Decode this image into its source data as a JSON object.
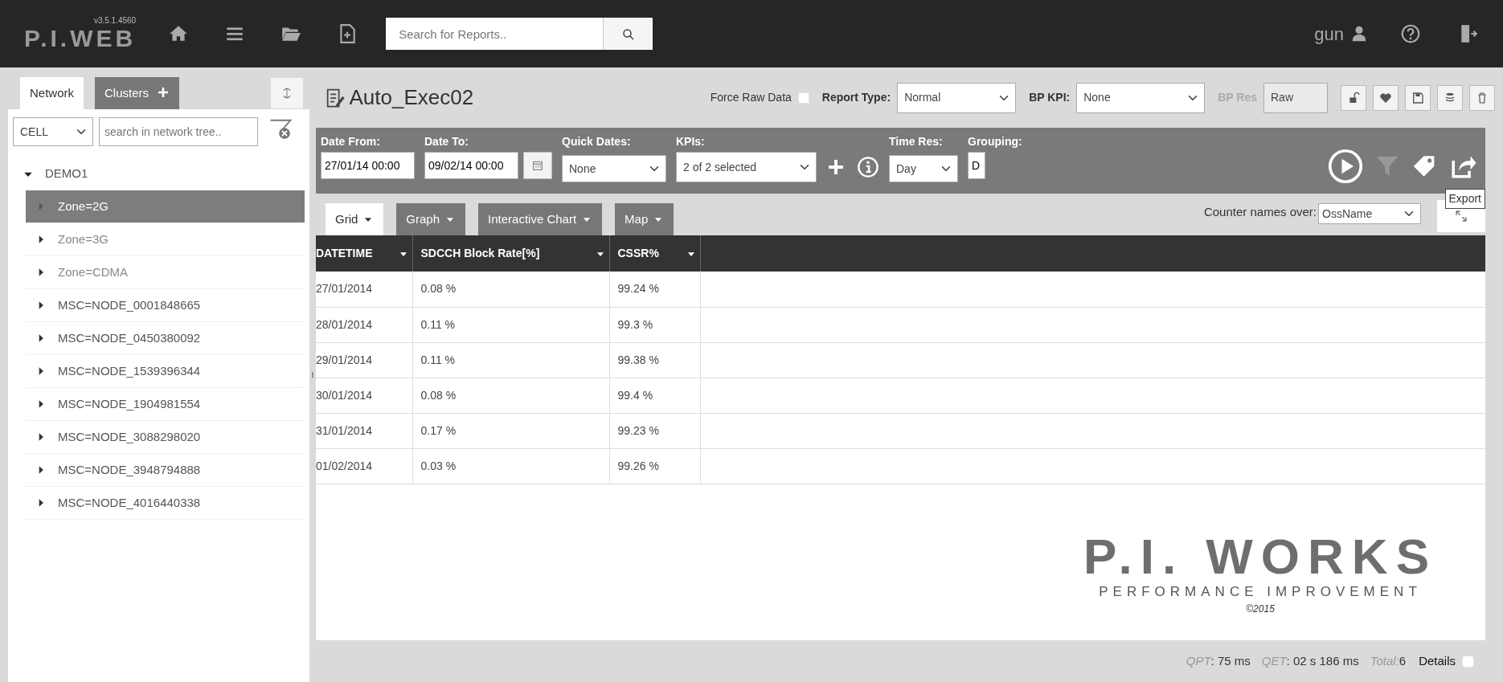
{
  "topbar": {
    "logo": "P.I.WEB",
    "version": "v3.5.1.4560",
    "search": {
      "placeholder": "Search for Reports.."
    },
    "user": "gun"
  },
  "sidebar": {
    "tabs": [
      {
        "label": "Network",
        "selected": true
      },
      {
        "label": "Clusters",
        "selected": false
      }
    ],
    "level_select": "CELL",
    "search": {
      "placeholder": "search in network tree.."
    },
    "tree": [
      {
        "label": "DEMO1",
        "expanded": true,
        "selected": false,
        "disabled": false,
        "children": [
          {
            "label": "Zone=2G",
            "expanded": false,
            "selected": true,
            "disabled": false
          },
          {
            "label": "Zone=3G",
            "expanded": false,
            "selected": false,
            "disabled": true
          },
          {
            "label": "Zone=CDMA",
            "expanded": false,
            "selected": false,
            "disabled": true
          },
          {
            "label": "MSC=NODE_0001848665",
            "expanded": false,
            "selected": false,
            "disabled": false
          },
          {
            "label": "MSC=NODE_0450380092",
            "expanded": false,
            "selected": false,
            "disabled": false
          },
          {
            "label": "MSC=NODE_1539396344",
            "expanded": false,
            "selected": false,
            "disabled": false
          },
          {
            "label": "MSC=NODE_1904981554",
            "expanded": false,
            "selected": false,
            "disabled": false
          },
          {
            "label": "MSC=NODE_3088298020",
            "expanded": false,
            "selected": false,
            "disabled": false
          },
          {
            "label": "MSC=NODE_3948794888",
            "expanded": false,
            "selected": false,
            "disabled": false
          },
          {
            "label": "MSC=NODE_4016440338",
            "expanded": false,
            "selected": false,
            "disabled": false
          }
        ]
      }
    ]
  },
  "report": {
    "title": "Auto_Exec02",
    "force_raw": {
      "label": "Force Raw Data",
      "checked": false
    },
    "selects": [
      {
        "label": "Report Type:",
        "value": "Normal",
        "disabled": false
      },
      {
        "label": "BP KPI:",
        "value": "None",
        "disabled": false
      },
      {
        "label": "BP Res",
        "value": "Raw",
        "disabled": true
      }
    ]
  },
  "filters": [
    {
      "kind": "input",
      "label": "Date From:",
      "value": "27/01/14 00:00"
    },
    {
      "kind": "input",
      "label": "Date To:",
      "value": "09/02/14 00:00"
    },
    {
      "kind": "calendar"
    },
    {
      "kind": "select",
      "label": "Quick Dates:",
      "value": "None"
    },
    {
      "kind": "multiselect",
      "label": "KPIs:",
      "value": "2 of 2 selected"
    },
    {
      "kind": "actions"
    },
    {
      "kind": "select",
      "label": "Time Res:",
      "value": "Day"
    },
    {
      "kind": "input",
      "label": "Grouping:",
      "value": "D"
    }
  ],
  "views": [
    {
      "label": "Grid",
      "selected": true
    },
    {
      "label": "Graph",
      "selected": false
    },
    {
      "label": "Interactive Chart",
      "selected": false
    },
    {
      "label": "Map",
      "selected": false
    }
  ],
  "counter_names": {
    "label": "Counter names over:",
    "value": "OssName"
  },
  "tooltip": "Export",
  "table": {
    "columns": [
      "DATETIME",
      "SDCCH Block Rate[%]",
      "CSSR%"
    ],
    "rows": [
      [
        "27/01/2014",
        "0.08 %",
        "99.24 %"
      ],
      [
        "28/01/2014",
        "0.11 %",
        "99.3 %"
      ],
      [
        "29/01/2014",
        "0.11 %",
        "99.38 %"
      ],
      [
        "30/01/2014",
        "0.08 %",
        "99.4 %"
      ],
      [
        "31/01/2014",
        "0.17 %",
        "99.23 %"
      ],
      [
        "01/02/2014",
        "0.03 %",
        "99.26 %"
      ]
    ]
  },
  "brand": {
    "name": "P.I. WORKS",
    "tagline": "PERFORMANCE IMPROVEMENT",
    "copyright": "©2015"
  },
  "status_bar": {
    "stats": [
      {
        "label": "QPT",
        "value": ": 75 ms"
      },
      {
        "label": "QET",
        "value": ": 02 s 186 ms"
      },
      {
        "label": "Total:",
        "value": "6"
      }
    ],
    "details": {
      "label": "Details",
      "checked": false
    }
  }
}
